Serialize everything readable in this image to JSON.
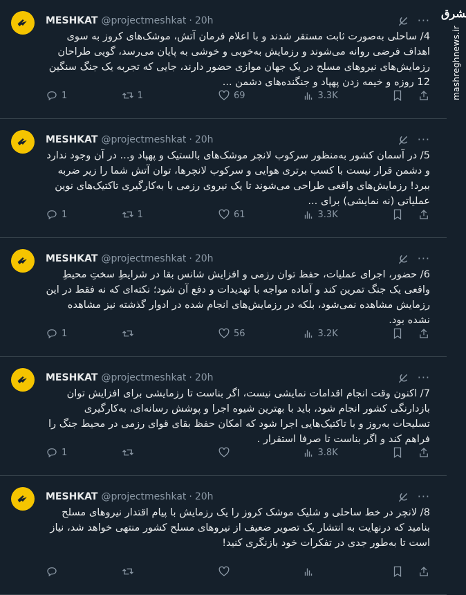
{
  "watermark": {
    "logo": "مشرق",
    "site": "mashreghnews.ir"
  },
  "colors": {
    "background": "#15202b",
    "text": "#e7e9ea",
    "muted": "#8b98a5",
    "avatar": "#f5c400"
  },
  "tweets": [
    {
      "name": "MESHKAT",
      "handle": "@projectmeshkat",
      "time": "20h",
      "text": "4/ ساحلی به‌صورت ثابت مستقر شدند و با اعلام فرمان آتش، موشک‌های کروز به سوی اهداف فرضی روانه می‌شوند و رزمایش به‌خوبی و خوشی به پایان می‌رسد، گویی طراحان رزمایش‌های نیروهای مسلح در یک جهان موازی حضور دارند، جایی که تجربه یک جنگ سنگین 12 روزه و خیمه زدن پهپاد و جنگنده‌های دشمن ...",
      "replies": "1",
      "reposts": "1",
      "likes": "69",
      "views": "3.3K"
    },
    {
      "name": "MESHKAT",
      "handle": "@projectmeshkat",
      "time": "20h",
      "text": "5/ در آسمان کشور به‌منظور سرکوب لانچر موشک‌های بالستیک و پهپاد و... در آن وجود ندارد و دشمن قرار نیست با کسب برتری هوایی و سرکوب لانچرها، توان آتش شما را زیر ضربه ببرد! رزمایش‌های واقعی طراحی می‌شوند تا یک نیروی رزمی با به‌کارگیری تاکتیک‌های نوین عملیاتی (نه نمایشی) برای ...",
      "replies": "1",
      "reposts": "1",
      "likes": "61",
      "views": "3.3K"
    },
    {
      "name": "MESHKAT",
      "handle": "@projectmeshkat",
      "time": "20h",
      "text": "6/ حضور، اجرای عملیات، حفظ توان رزمی و افزایش شانس بقا در شرایطِ سختِ محیطِ واقعی یک جنگ تمرین کند و آماده مواجه با تهدیدات و دفع آن شود؛ نکته‌ای که نه فقط در این رزمایش مشاهده نمی‌شود، بلکه در رزمایش‌های انجام شده در ادوار گذشته نیز مشاهده نشده بود.",
      "replies": "1",
      "reposts": "",
      "likes": "56",
      "views": "3.2K"
    },
    {
      "name": "MESHKAT",
      "handle": "@projectmeshkat",
      "time": "20h",
      "text": "7/ اکنون وقت انجام اقدامات نمایشی نیست، اگر بناست تا رزمایشی برای افزایش توان بازدارنگی کشور انجام شود، باید با بهترین شیوه اجرا و پوشش رسانه‌ای، به‌کارگیری تسلیحات به‌روز و با تاکتیک‌هایی اجرا شود که امکان حفظ بقای قوای رزمی در محیط جنگ را فراهم کند و اگر بناست تا صرفا استقرار .",
      "replies": "1",
      "reposts": "",
      "likes": "",
      "views": "3.8K"
    },
    {
      "name": "MESHKAT",
      "handle": "@projectmeshkat",
      "time": "20h",
      "text": "8/ لانچر در خط ساحلی و شلیک موشک کروز را یک رزمایش با پیام اقتدار نیروهای مسلح بنامید که درنهایت به انتشار یک تصویر ضعیف از نیروهای مسلح کشور منتهی خواهد شد، نیاز است تا به‌طور جدی در تفکرات خود بازنگری کنید!",
      "replies": "",
      "reposts": "",
      "likes": "",
      "views": ""
    }
  ]
}
